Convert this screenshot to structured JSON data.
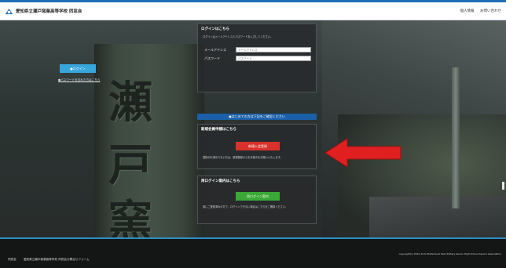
{
  "header": {
    "site_title": "愛知県立瀬戸窯業高等学校 同窓会",
    "links": [
      "個人情報",
      "お問い合わせ"
    ]
  },
  "hero": {
    "stone_characters": [
      "瀬",
      "戸",
      "窯"
    ]
  },
  "login": {
    "title": "ログインはこちら",
    "description": "ログインはメールアドレスとパスワードを入力してください。",
    "email_label": "メールアドレス",
    "email_placeholder": "メールアドレス",
    "password_label": "パスワード",
    "password_placeholder": "パスワード",
    "login_button": "●ログイン",
    "forgot_link": "●パスワードを忘れた方はこちら"
  },
  "first_time_bar": "●はじめての方は下記をご確認ください",
  "apply": {
    "title": "新規会員申請はこちら",
    "button": "新規入会登録",
    "note": "登録がお済みでない方は、新規登録からお手続きをお願いいたします。"
  },
  "relogin": {
    "title": "再ログイン案内はこちら",
    "button": "再ログイン案内",
    "note": "既にご登録済みの方で、ログインできない場合はこちらをご確認ください。"
  },
  "footer": {
    "links": [
      "同窓会",
      "愛知県立瀬戸窯業高等学校 同窓会お問合せフォーム"
    ],
    "copyright": "copyright(c) 2021 Aichi Prefectural Seto Pottery Senior High School Alumni Association"
  },
  "colors": {
    "header_accent": "#1f6fb5",
    "login_button": "#36a6dc",
    "first_bar": "#1b5fa8",
    "apply_button": "#d9322c",
    "relogin_button": "#3aa836",
    "arrow": "#e02020"
  }
}
